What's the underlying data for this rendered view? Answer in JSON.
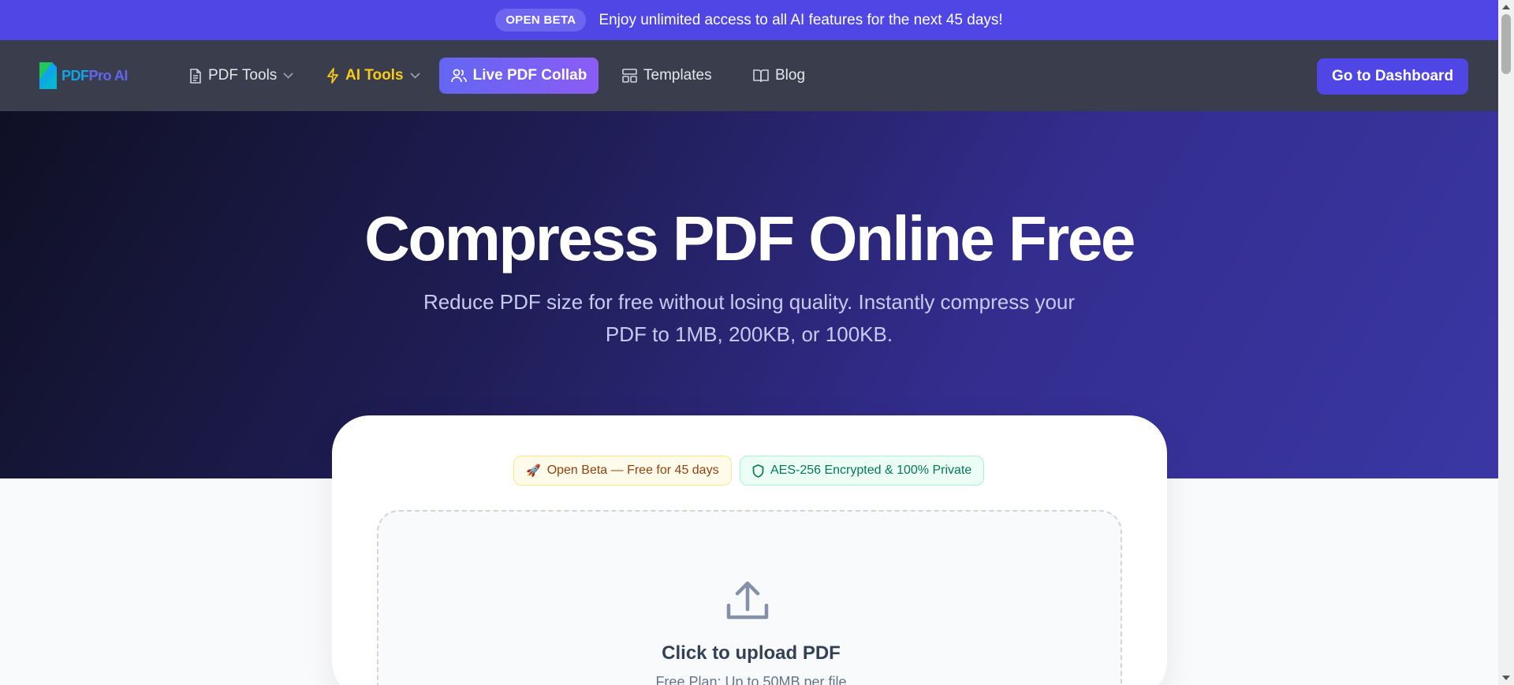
{
  "banner": {
    "pill": "OPEN BETA",
    "text": "Enjoy unlimited access to all AI features for the next 45 days!"
  },
  "logo": {
    "part1": "PDF",
    "part2": "Pro AI"
  },
  "nav": {
    "pdf_tools": "PDF Tools",
    "ai_tools": "AI Tools",
    "live_collab": "Live PDF Collab",
    "templates": "Templates",
    "blog": "Blog",
    "dashboard": "Go to Dashboard"
  },
  "hero": {
    "title": "Compress PDF Online Free",
    "subtitle": "Reduce PDF size for free without losing quality. Instantly compress your PDF to 1MB, 200KB, or 100KB."
  },
  "card": {
    "badge_beta": "Open Beta — Free for 45 days",
    "badge_secure": "AES-256 Encrypted & 100% Private",
    "upload_title": "Click to upload PDF",
    "upload_sub": "Free Plan: Up to 50MB per file"
  },
  "colors": {
    "brand": "#4f46e5",
    "nav_bg": "#3a3d4b",
    "ai_accent": "#facc15"
  }
}
